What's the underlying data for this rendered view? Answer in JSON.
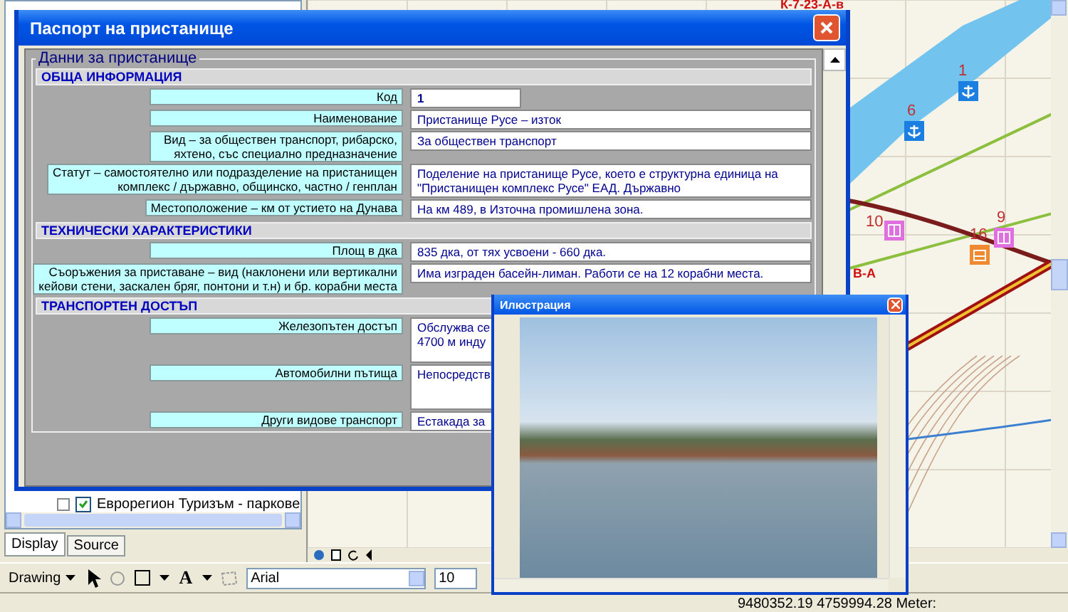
{
  "app": {
    "map_labels": [
      {
        "text": "К-7-23-А-в"
      },
      {
        "text": "В-А"
      }
    ],
    "markers": [
      {
        "number": "1",
        "kind": "anchor"
      },
      {
        "number": "6",
        "kind": "anchor"
      },
      {
        "number": "10",
        "kind": "building"
      },
      {
        "number": "9",
        "kind": "building"
      },
      {
        "number": "16",
        "kind": "factory"
      }
    ],
    "toc": {
      "layers": [
        {
          "name": "Еврорегион Туризъм - паркове",
          "checked": true
        }
      ],
      "tabs": [
        {
          "label": "Display",
          "selected": true
        },
        {
          "label": "Source",
          "selected": false
        }
      ]
    },
    "drawing_toolbar": {
      "menu": "Drawing",
      "text_tool": "A",
      "font": "Arial",
      "font_size": "10"
    },
    "status_bar": {
      "coordinates": "9480352.19  4759994.28 Meter:"
    }
  },
  "passport_window": {
    "title": "Паспорт на пристанище",
    "group": "Данни за пристанище",
    "sections": [
      {
        "title": "ОБЩА ИНФОРМАЦИЯ",
        "rows": [
          {
            "kind": "short",
            "label": "Код",
            "value": "1"
          },
          {
            "kind": "long",
            "label": "Наименование",
            "value": "Пристанище Русе – изток"
          },
          {
            "kind": "long",
            "label": "Вид – за обществен транспорт, рибарско,\nяхтено, със специално предназначение",
            "value": "За обществен транспорт"
          },
          {
            "kind": "long",
            "label": "Статут – самостоятелно или подразделение на пристанищен\nкомплекс / държавно, общинско, частно / генплан",
            "value": "Поделение на пристанище Русе, което е структурна единица на\n\"Пристанищен комплекс Русе\" ЕАД. Държавно"
          },
          {
            "kind": "long",
            "label": "Местоположение – км от устието на Дунава",
            "value": "На км 489, в Източна промишлена зона."
          }
        ]
      },
      {
        "title": "ТЕХНИЧЕСКИ ХАРАКТЕРИСТИКИ",
        "rows": [
          {
            "kind": "long",
            "label": "Площ в дка",
            "value": "835 дка, от тях усвоени - 660 дка."
          },
          {
            "kind": "long",
            "label": "Съоръжения за приставане – вид (наклонени или вертикални\nкейови стени, заскален бряг, понтони и т.н) и бр. корабни места",
            "value": "Има изграден басейн-лиман. Работи се на 12 корабни места."
          }
        ]
      },
      {
        "title": "ТРАНСПОРТЕН ДОСТЪП",
        "rows": [
          {
            "kind": "tall",
            "label": "Железопътен достъп",
            "value": "Обслужва се\n4700 м инду"
          },
          {
            "kind": "tall",
            "label": "Автомобилни пътища",
            "value": "Непосредств"
          },
          {
            "kind": "long",
            "label": "Други видове транспорт",
            "value": "Естакада за"
          }
        ]
      }
    ]
  },
  "illustration_window": {
    "title": "Илюстрация"
  }
}
